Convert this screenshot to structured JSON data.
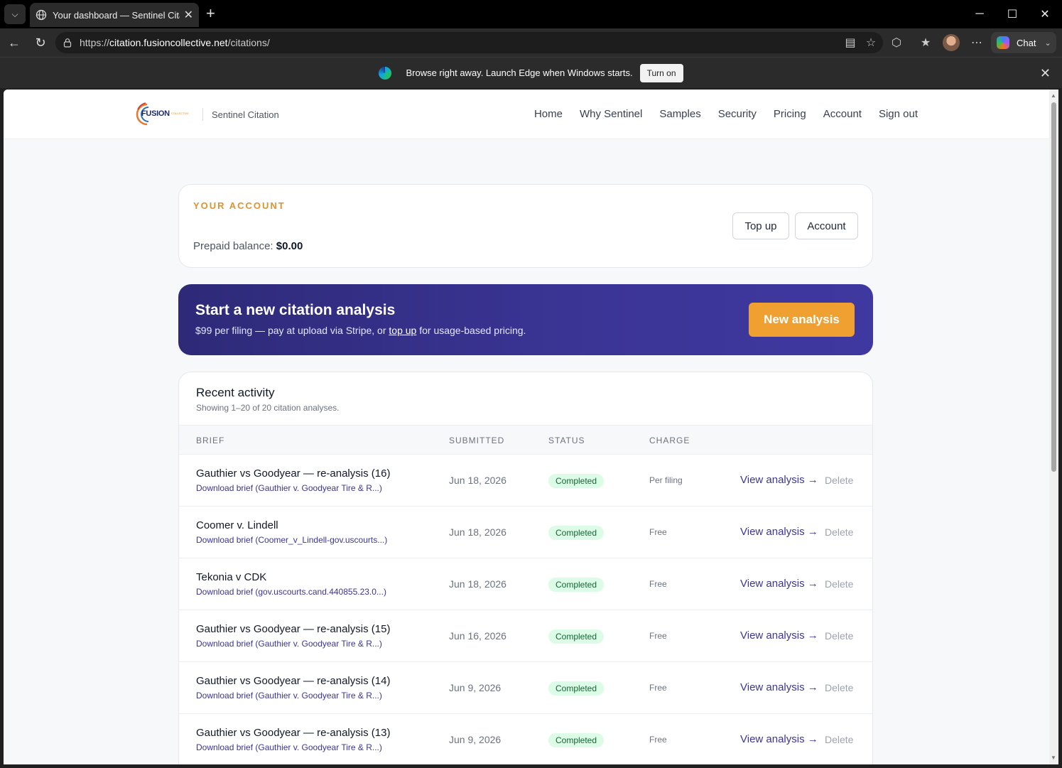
{
  "browser": {
    "tab_title": "Your dashboard — Sentinel Citation",
    "url_prefix": "https://",
    "url_host": "citation.fusioncollective.net",
    "url_path": "/citations/",
    "copilot_label": "Chat",
    "infobar_text": "Browse right away. Launch Edge when Windows starts.",
    "infobar_button": "Turn on"
  },
  "header": {
    "brand_name": "FUSION",
    "brand_sub": "COLLECTIVE",
    "product": "Sentinel Citation",
    "nav": [
      "Home",
      "Why Sentinel",
      "Samples",
      "Security",
      "Pricing",
      "Account",
      "Sign out"
    ]
  },
  "account": {
    "eyebrow": "YOUR ACCOUNT",
    "balance_label": "Prepaid balance:",
    "balance_value": "$0.00",
    "topup_label": "Top up",
    "account_label": "Account"
  },
  "hero": {
    "title": "Start a new citation analysis",
    "text_before": "$99 per filing — pay at upload via Stripe, or ",
    "link": "top up",
    "text_after": " for usage-based pricing.",
    "button": "New analysis"
  },
  "activity": {
    "title": "Recent activity",
    "subtitle": "Showing 1–20 of 20 citation analyses.",
    "columns": [
      "BRIEF",
      "SUBMITTED",
      "STATUS",
      "CHARGE"
    ],
    "rows": [
      {
        "brief": "Gauthier vs Goodyear — re-analysis (16)",
        "download": "Download brief (Gauthier v. Goodyear Tire & R...)",
        "date": "Jun 18, 2026",
        "status": "Completed",
        "charge": "Per filing",
        "view": "View analysis →",
        "delete": "Delete"
      },
      {
        "brief": "Coomer v. Lindell",
        "download": "Download brief (Coomer_v_Lindell-gov.uscourts...)",
        "date": "Jun 18, 2026",
        "status": "Completed",
        "charge": "Free",
        "view": "View analysis →",
        "delete": "Delete"
      },
      {
        "brief": "Tekonia v CDK",
        "download": "Download brief (gov.uscourts.cand.440855.23.0...)",
        "date": "Jun 18, 2026",
        "status": "Completed",
        "charge": "Free",
        "view": "View analysis →",
        "delete": "Delete"
      },
      {
        "brief": "Gauthier vs Goodyear — re-analysis (15)",
        "download": "Download brief (Gauthier v. Goodyear Tire & R...)",
        "date": "Jun 16, 2026",
        "status": "Completed",
        "charge": "Free",
        "view": "View analysis →",
        "delete": "Delete"
      },
      {
        "brief": "Gauthier vs Goodyear — re-analysis (14)",
        "download": "Download brief (Gauthier v. Goodyear Tire & R...)",
        "date": "Jun 9, 2026",
        "status": "Completed",
        "charge": "Free",
        "view": "View analysis →",
        "delete": "Delete"
      },
      {
        "brief": "Gauthier vs Goodyear — re-analysis (13)",
        "download": "Download brief (Gauthier v. Goodyear Tire & R...)",
        "date": "Jun 9, 2026",
        "status": "Completed",
        "charge": "Free",
        "view": "View analysis →",
        "delete": "Delete"
      }
    ]
  },
  "colors": {
    "accent_orange": "#f0a030",
    "hero_indigo": "#3b3596",
    "badge_green_bg": "#dcfce7",
    "badge_green_text": "#166534"
  },
  "icons": [
    "tab-actions-icon",
    "globe-icon",
    "close-icon",
    "plus-icon",
    "minimize-icon",
    "maximize-icon",
    "back-icon",
    "refresh-icon",
    "lock-icon",
    "reader-icon",
    "favorite-star-icon",
    "extensions-icon",
    "favorites-icon",
    "more-icon",
    "edge-icon"
  ]
}
